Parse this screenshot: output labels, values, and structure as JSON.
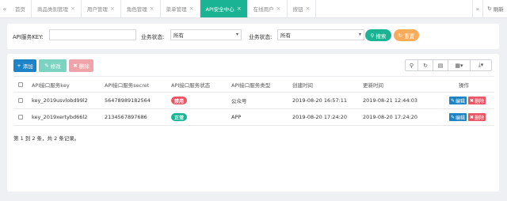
{
  "tabbar": {
    "tabs": [
      {
        "label": "首页",
        "closable": false,
        "active": false
      },
      {
        "label": "商品类别管理",
        "closable": true,
        "active": false
      },
      {
        "label": "用户管理",
        "closable": true,
        "active": false
      },
      {
        "label": "角色管理",
        "closable": true,
        "active": false
      },
      {
        "label": "菜单管理",
        "closable": true,
        "active": false
      },
      {
        "label": "API安全中心",
        "closable": true,
        "active": true
      },
      {
        "label": "在线用户",
        "closable": true,
        "active": false
      },
      {
        "label": "按钮",
        "closable": true,
        "active": false
      }
    ],
    "close_glyph": "×",
    "refresh_label": "刷新"
  },
  "search": {
    "key_label": "API服务KEY:",
    "key_value": "",
    "status1_label": "业务状态:",
    "status1_value": "所有",
    "status2_label": "业务状态:",
    "status2_value": "所有",
    "search_label": "搜索",
    "reset_label": "重置"
  },
  "toolbar": {
    "add_label": "添加",
    "edit_label": "修改",
    "delete_label": "删除"
  },
  "table": {
    "columns": [
      "API接口服务key",
      "API接口服务secret",
      "API接口服务状态",
      "API接口服务类型",
      "创建时间",
      "更新时间",
      "操作"
    ],
    "rows": [
      {
        "key": "key_2019usvlobd99l2",
        "secret": "56478989182564",
        "status": "禁用",
        "status_color": "#ed5565",
        "type": "公众号",
        "created": "2019-08-20 16:57:11",
        "updated": "2019-08-21 12:44:03",
        "edit_label": "编辑",
        "delete_label": "删除"
      },
      {
        "key": "key_2019xertybd66l2",
        "secret": "2134567897686",
        "status": "正常",
        "status_color": "#1ab394",
        "type": "APP",
        "created": "2019-08-20 17:24:20",
        "updated": "2019-08-20 17:24:20",
        "edit_label": "编辑",
        "delete_label": "删除"
      }
    ],
    "footer": "第 1 到 2 条，共 2 条记录。"
  },
  "colors": {
    "primary": "#1ab394",
    "blue": "#1c84c6",
    "warning": "#f8ac59",
    "danger": "#ed5565"
  }
}
